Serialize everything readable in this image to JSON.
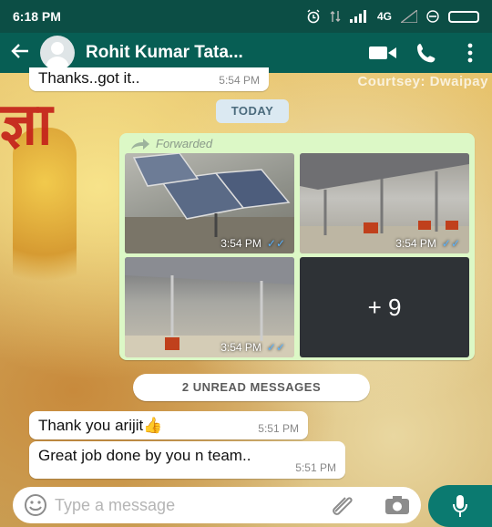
{
  "status_bar": {
    "time": "6:18 PM",
    "network": "4G"
  },
  "contact": {
    "name": "Rohit Kumar Tata..."
  },
  "wallpaper": {
    "caption": "Courtsey: Dwaipay",
    "glyph": "ज्ञा"
  },
  "messages": {
    "top": {
      "text": "Thanks..got it..",
      "time": "5:54 PM"
    },
    "date_chip": "TODAY",
    "forwarded": {
      "label": "Forwarded",
      "photos": [
        {
          "time": "3:54 PM"
        },
        {
          "time": "3:54 PM"
        },
        {
          "time": "3:54 PM"
        }
      ],
      "more_count": "+ 9"
    },
    "unread_banner": "2 UNREAD MESSAGES",
    "list": [
      {
        "text": "Thank you arijit👍",
        "time": "5:51 PM"
      },
      {
        "text": "Great job done by you n team..",
        "time": "5:51 PM"
      }
    ]
  },
  "input": {
    "placeholder": "Type a message"
  },
  "colors": {
    "header": "#075e54",
    "status": "#0c4e45",
    "outgoing": "#dcf8c6",
    "accent": "#0b7a70"
  }
}
